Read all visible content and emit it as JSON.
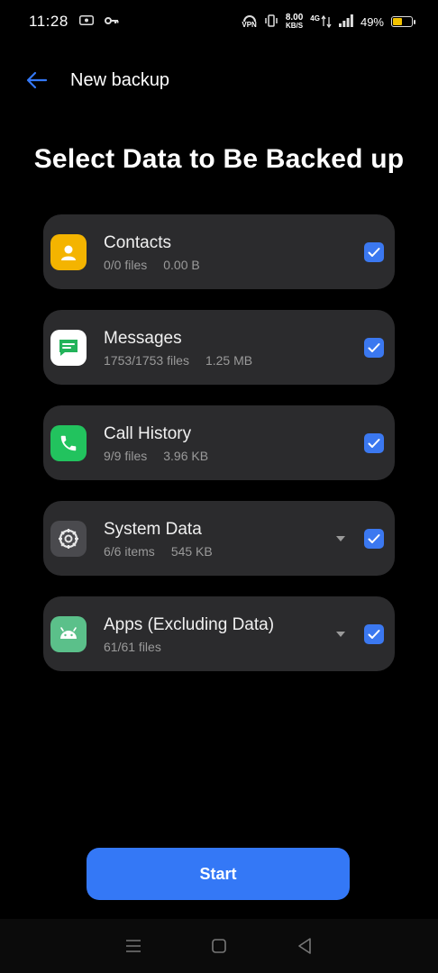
{
  "status_bar": {
    "time": "11:28",
    "vpn_label": "VPN",
    "speed_value": "8.00",
    "speed_unit": "KB/S",
    "network_label": "4G",
    "battery_percent": "49%",
    "battery_level": 0.49,
    "battery_color": "#f2c200"
  },
  "appbar": {
    "title": "New backup"
  },
  "heading": "Select Data to Be Backed up",
  "items": [
    {
      "name": "Contacts",
      "count": "0/0 files",
      "size": "0.00 B",
      "icon": "contact-icon",
      "icon_color": "#f4b400",
      "expandable": false,
      "checked": true
    },
    {
      "name": "Messages",
      "count": "1753/1753 files",
      "size": "1.25 MB",
      "icon": "message-icon",
      "icon_color": "#ffffff",
      "expandable": false,
      "checked": true
    },
    {
      "name": "Call History",
      "count": "9/9 files",
      "size": "3.96 KB",
      "icon": "phone-icon",
      "icon_color": "#22c35e",
      "expandable": false,
      "checked": true
    },
    {
      "name": "System Data",
      "count": "6/6 items",
      "size": "545 KB",
      "icon": "settings-icon",
      "icon_color": "#4a4a4e",
      "expandable": true,
      "checked": true
    },
    {
      "name": "Apps (Excluding Data)",
      "count": "61/61 files",
      "size": "",
      "icon": "android-icon",
      "icon_color": "#5bc08a",
      "expandable": true,
      "checked": true
    }
  ],
  "start_button": {
    "label": "Start",
    "color": "#3478f6"
  },
  "colors": {
    "accent": "#3478f6",
    "checkbox": "#3b78f0",
    "card_bg": "#2b2b2d",
    "background": "#000000"
  }
}
